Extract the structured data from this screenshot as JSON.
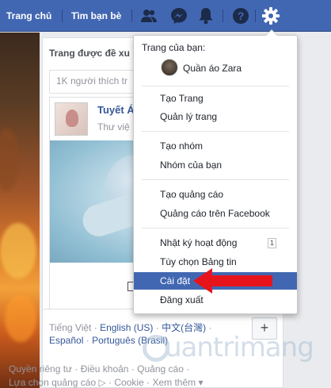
{
  "topbar": {
    "home_label": "Trang chủ",
    "find_friends_label": "Tìm bạn bè",
    "icons": [
      "friends-icon",
      "messenger-icon",
      "notifications-icon",
      "help-icon",
      "settings-gear-icon"
    ],
    "color": "#4267b2"
  },
  "main": {
    "card_title": "Trang được đề xu",
    "likes_text": "1K người thích tr",
    "page_preview": {
      "name": "Tuyết Á",
      "category": "Thư việ",
      "like_fragment": "Ư"
    }
  },
  "languages": {
    "current": "Tiếng Việt",
    "links": [
      "English (US)",
      "中文(台灣)",
      "Español",
      "Português (Brasil)"
    ],
    "add_label": "+"
  },
  "footer": {
    "line1": [
      "Quyền riêng tư",
      "Điều khoản",
      "Quảng cáo"
    ],
    "line2": [
      "Lựa chọn quảng cáo",
      "Cookie",
      "Xem thêm"
    ]
  },
  "menu": {
    "header": "Trang của bạn:",
    "page_name": "Quần áo Zara",
    "items": [
      {
        "label": "Tạo Trang"
      },
      {
        "label": "Quản lý trang"
      },
      {
        "label": "Tạo nhóm"
      },
      {
        "label": "Nhóm của bạn"
      },
      {
        "label": "Tạo quảng cáo"
      },
      {
        "label": "Quảng cáo trên Facebook"
      },
      {
        "label": "Nhật ký hoạt động",
        "badge": "1"
      },
      {
        "label": "Tùy chọn Bảng tin"
      },
      {
        "label": "Cài đặt",
        "active": true
      },
      {
        "label": "Đăng xuất"
      }
    ],
    "active_color": "#4267b2"
  },
  "watermark": "uantrimang",
  "annotation_arrow_color": "#e8141b"
}
